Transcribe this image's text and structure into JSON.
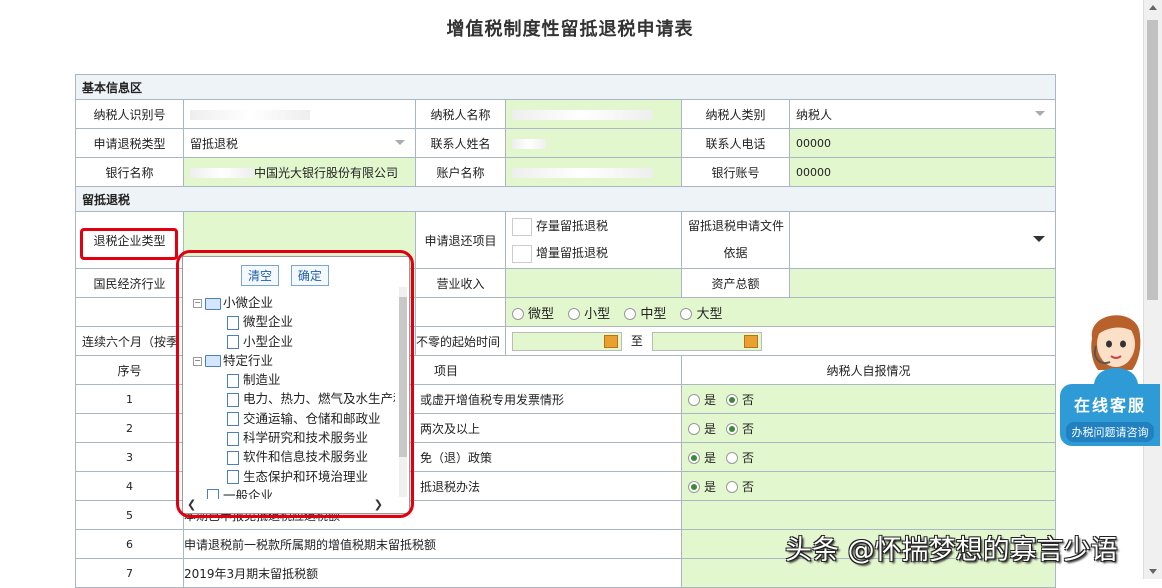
{
  "page": {
    "title": "增值税制度性留抵退税申请表"
  },
  "basic": {
    "section": "基本信息区",
    "taxpayer_id_label": "纳税人识别号",
    "taxpayer_name_label": "纳税人名称",
    "taxpayer_type_label": "纳税人类别",
    "taxpayer_type_value": "纳税人",
    "refund_type_label": "申请退税类型",
    "refund_type_value": "留抵退税",
    "contact_name_label": "联系人姓名",
    "contact_phone_label": "联系人电话",
    "contact_phone_value": "00000",
    "bank_name_label": "银行名称",
    "bank_name_value": "中国光大银行股份有限公司",
    "account_name_label": "账户名称",
    "bank_account_label": "银行账号",
    "bank_account_value": "00000"
  },
  "retain": {
    "section": "留抵退税",
    "enterprise_type_label": "退税企业类型",
    "refund_item_label": "申请退还项目",
    "opt_stock": "存量留抵退税",
    "opt_increment": "增量留抵退税",
    "basis_label_1": "留抵退税申请文件",
    "basis_label_2": "依据",
    "industry_label": "国民经济行业",
    "revenue_label": "营业收入",
    "assets_label": "资产总额",
    "scale_options": [
      "微型",
      "小型",
      "中型",
      "大型"
    ],
    "six_month_label": "连续六个月（按季",
    "start_time_label": "不零的起始时间",
    "to_label": "至"
  },
  "grid": {
    "col_seq": "序号",
    "col_item": "项目",
    "col_self": "纳税人自报情况",
    "yes": "是",
    "no": "否",
    "rows": [
      {
        "seq": "1",
        "item": "或虚开增值税专用发票情形",
        "answer": "否"
      },
      {
        "seq": "2",
        "item": "两次及以上",
        "answer": "否"
      },
      {
        "seq": "3",
        "item": "免（退）政策",
        "answer": "是"
      },
      {
        "seq": "4",
        "item": "抵退税办法",
        "answer": "是"
      },
      {
        "seq": "5",
        "item": "本期已申报免抵退税应退税额",
        "answer": ""
      },
      {
        "seq": "6",
        "item": "申请退税前一税款所属期的增值税期末留抵税额",
        "answer": ""
      },
      {
        "seq": "7",
        "item": "2019年3月期末留抵税额",
        "answer": ""
      }
    ]
  },
  "dropdown": {
    "clear_label": "清空",
    "confirm_label": "确定",
    "groups": [
      {
        "label": "小微企业",
        "children": [
          "微型企业",
          "小型企业"
        ]
      },
      {
        "label": "特定行业",
        "children": [
          "制造业",
          "电力、热力、燃气及水生产和",
          "交通运输、仓储和邮政业",
          "科学研究和技术服务业",
          "软件和信息技术服务业",
          "生态保护和环境治理业"
        ]
      },
      {
        "label": "一般企业",
        "children": []
      }
    ]
  },
  "service": {
    "title": "在线客服",
    "subtitle": "办税问题请咨询"
  },
  "watermark": "头条 @怀揣梦想的寡言少语"
}
